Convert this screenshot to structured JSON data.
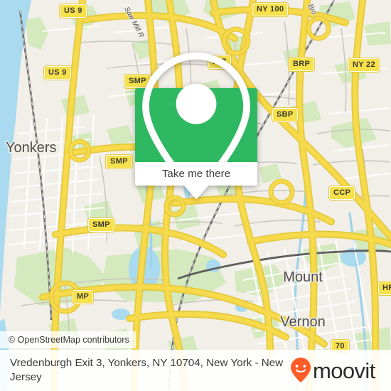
{
  "map": {
    "provider_attribution": "© OpenStreetMap contributors",
    "colors": {
      "land": "#f2efe9",
      "water": "#aadaef",
      "park": "#cfe8b6",
      "highway": "#f7d94c",
      "motorway_casing": "#e8c63a",
      "minor_road": "#ffffff",
      "rail": "#6b6b6b",
      "shield_fill": "#f7e14a",
      "shield_text": "#3a3a32",
      "label_text": "#4e4e4e"
    },
    "place_labels": [
      {
        "name": "Yonkers",
        "line1": "Yonkers",
        "line2": ""
      },
      {
        "name": "Mount Vernon",
        "line1": "Mount",
        "line2": "Vernon"
      }
    ],
    "water_labels": [
      {
        "text": "Saw Mill R"
      },
      {
        "text": "Bro"
      }
    ],
    "road_shields": [
      {
        "label": "US 9"
      },
      {
        "label": "NY 100"
      },
      {
        "label": "US 9"
      },
      {
        "label": "I 87"
      },
      {
        "label": "BRP"
      },
      {
        "label": "NY 22"
      },
      {
        "label": "SMP"
      },
      {
        "label": "SBP"
      },
      {
        "label": "SMP"
      },
      {
        "label": "CCP"
      },
      {
        "label": "SMP"
      },
      {
        "label": "MP"
      },
      {
        "label": "HRP"
      },
      {
        "label": "70"
      }
    ]
  },
  "popup": {
    "icon": "map-pin-icon",
    "button_label": "Take me there",
    "accent_color": "#2eb862"
  },
  "bottom_bar": {
    "title": "Vredenburgh Exit 3, Yonkers, NY 10704, New York - New Jersey",
    "brand": "moovit",
    "brand_color": "#ff5b26",
    "brand_icon": "moovit-pin-icon"
  }
}
